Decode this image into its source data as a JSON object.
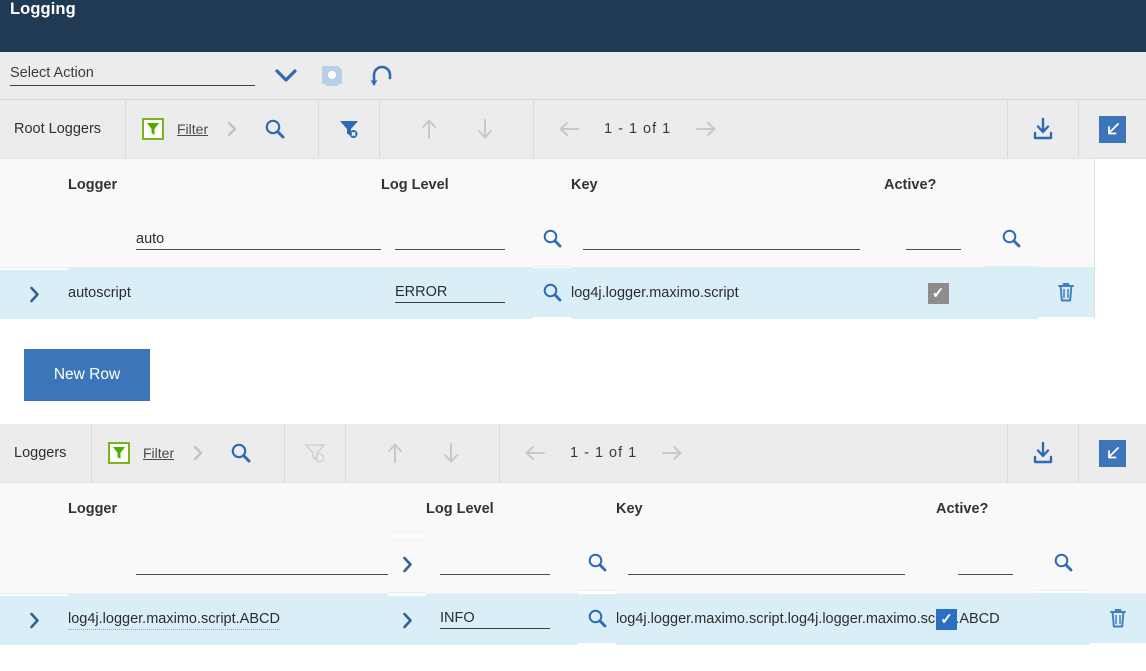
{
  "header": {
    "title": "Logging"
  },
  "action_bar": {
    "select_action_label": "Select Action",
    "dropdown_icon": "chevron-down-icon",
    "save_icon": "save-disk-icon",
    "revert_icon": "revert-arrow-icon"
  },
  "sections": [
    {
      "id": "root-loggers",
      "toolbar": {
        "label": "Root Loggers",
        "filter_icon": "filter-funnel-green-icon",
        "filter_label": "Filter",
        "filter_chevron_icon": "chevron-right-icon",
        "search_icon": "magnifier-icon",
        "clear_filter_icon": "clear-filter-funnel-icon",
        "clear_filter_enabled": true,
        "prev_row_icon": "arrow-up-icon",
        "next_row_icon": "arrow-down-icon",
        "prev_page_icon": "arrow-left-icon",
        "page_text": "1 - 1 of 1",
        "next_page_icon": "arrow-right-icon",
        "download_icon": "download-icon",
        "collapse_icon": "collapse-diagonal-icon"
      },
      "columns": [
        "Logger",
        "Log Level",
        "Key",
        "Active?"
      ],
      "filter_values": {
        "logger": "auto",
        "log_level": "",
        "key": "",
        "active": ""
      },
      "rows": [
        {
          "expand_icon": "chevron-right-icon",
          "logger": "autoscript",
          "logger_has_detail_menu": false,
          "log_level": "ERROR",
          "level_lookup_icon": "magnifier-icon",
          "key": "log4j.logger.maximo.script",
          "active": true,
          "active_checkbox_state": "checked-disabled",
          "delete_icon": "trash-icon"
        }
      ],
      "new_row_button": "New Row"
    },
    {
      "id": "loggers",
      "toolbar": {
        "label": "Loggers",
        "filter_icon": "filter-funnel-green-icon",
        "filter_label": "Filter",
        "filter_chevron_icon": "chevron-right-icon",
        "search_icon": "magnifier-icon",
        "clear_filter_icon": "clear-filter-funnel-icon",
        "clear_filter_enabled": false,
        "prev_row_icon": "arrow-up-icon",
        "next_row_icon": "arrow-down-icon",
        "prev_page_icon": "arrow-left-icon",
        "page_text": "1 - 1 of 1",
        "next_page_icon": "arrow-right-icon",
        "download_icon": "download-icon",
        "collapse_icon": "collapse-diagonal-icon"
      },
      "columns": [
        "Logger",
        "Log Level",
        "Key",
        "Active?"
      ],
      "filter_values": {
        "logger": "",
        "log_level": "",
        "key": "",
        "active": ""
      },
      "rows": [
        {
          "expand_icon": "chevron-right-icon",
          "logger": "log4j.logger.maximo.script.ABCD",
          "logger_has_detail_menu": true,
          "detail_menu_icon": "chevron-right-icon",
          "log_level": "INFO",
          "level_lookup_icon": "magnifier-icon",
          "key": "log4j.logger.maximo.script.log4j.logger.maximo.script.ABCD",
          "active": true,
          "active_checkbox_state": "checked-enabled",
          "delete_icon": "trash-icon"
        }
      ]
    }
  ],
  "colors": {
    "header_bg": "#1f3a52",
    "action_bar_bg": "#ececec",
    "toolbar_bg": "#ececec",
    "selected_row_bg": "#daeef7",
    "primary_blue": "#3d76b8",
    "checkbox_active": "#2a6fc0",
    "checkbox_disabled": "#8d8d8d",
    "filter_green": "#6aa81e"
  }
}
